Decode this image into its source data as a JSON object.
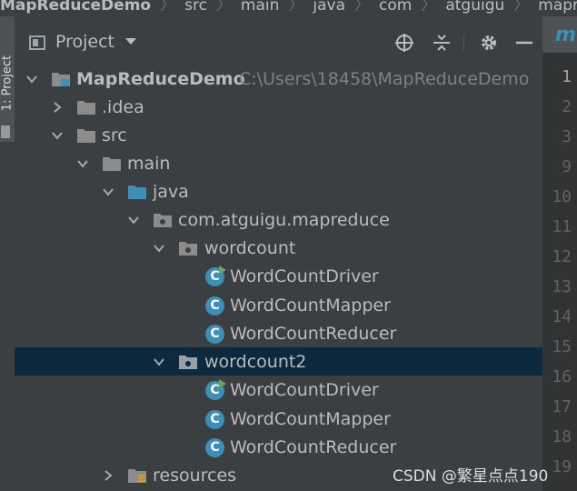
{
  "breadcrumb": [
    "MapReduceDemo",
    "src",
    "main",
    "java",
    "com",
    "atguigu",
    "mapreduce"
  ],
  "tool_strip": {
    "tab_label": "1: Project"
  },
  "panel": {
    "title": "Project"
  },
  "tree": [
    {
      "label": "MapReduceDemo",
      "path": "C:\\Users\\18458\\MapReduceDemo",
      "icon": "module-folder-icon",
      "state": "expanded"
    },
    {
      "label": ".idea",
      "icon": "folder-icon",
      "state": "collapsed"
    },
    {
      "label": "src",
      "icon": "folder-icon",
      "state": "expanded"
    },
    {
      "label": "main",
      "icon": "folder-icon",
      "state": "expanded"
    },
    {
      "label": "java",
      "icon": "source-folder-icon",
      "state": "expanded"
    },
    {
      "label": "com.atguigu.mapreduce",
      "icon": "package-icon",
      "state": "expanded"
    },
    {
      "label": "wordcount",
      "icon": "package-icon",
      "state": "expanded"
    },
    {
      "label": "WordCountDriver",
      "icon": "runnable-class-icon",
      "class_letter": "C"
    },
    {
      "label": "WordCountMapper",
      "icon": "class-icon",
      "class_letter": "C"
    },
    {
      "label": "WordCountReducer",
      "icon": "class-icon",
      "class_letter": "C"
    },
    {
      "label": "wordcount2",
      "icon": "package-icon",
      "state": "expanded",
      "selected": true
    },
    {
      "label": "WordCountDriver",
      "icon": "runnable-class-icon",
      "class_letter": "C"
    },
    {
      "label": "WordCountMapper",
      "icon": "class-icon",
      "class_letter": "C"
    },
    {
      "label": "WordCountReducer",
      "icon": "class-icon",
      "class_letter": "C"
    },
    {
      "label": "resources",
      "icon": "resources-folder-icon",
      "state": "collapsed"
    }
  ],
  "editor": {
    "tab_letter": "m",
    "line_numbers": [
      "1",
      "2",
      "3",
      "9",
      "10",
      "11",
      "12",
      "13",
      "14",
      "15",
      "16",
      "17",
      "18",
      "19"
    ]
  },
  "watermark": "CSDN @繁星点点190",
  "colors": {
    "selection": "#0d293e",
    "class_icon": "#3d8fb8",
    "panel_bg": "#3c3f41",
    "editor_bg": "#2b2b2b"
  }
}
